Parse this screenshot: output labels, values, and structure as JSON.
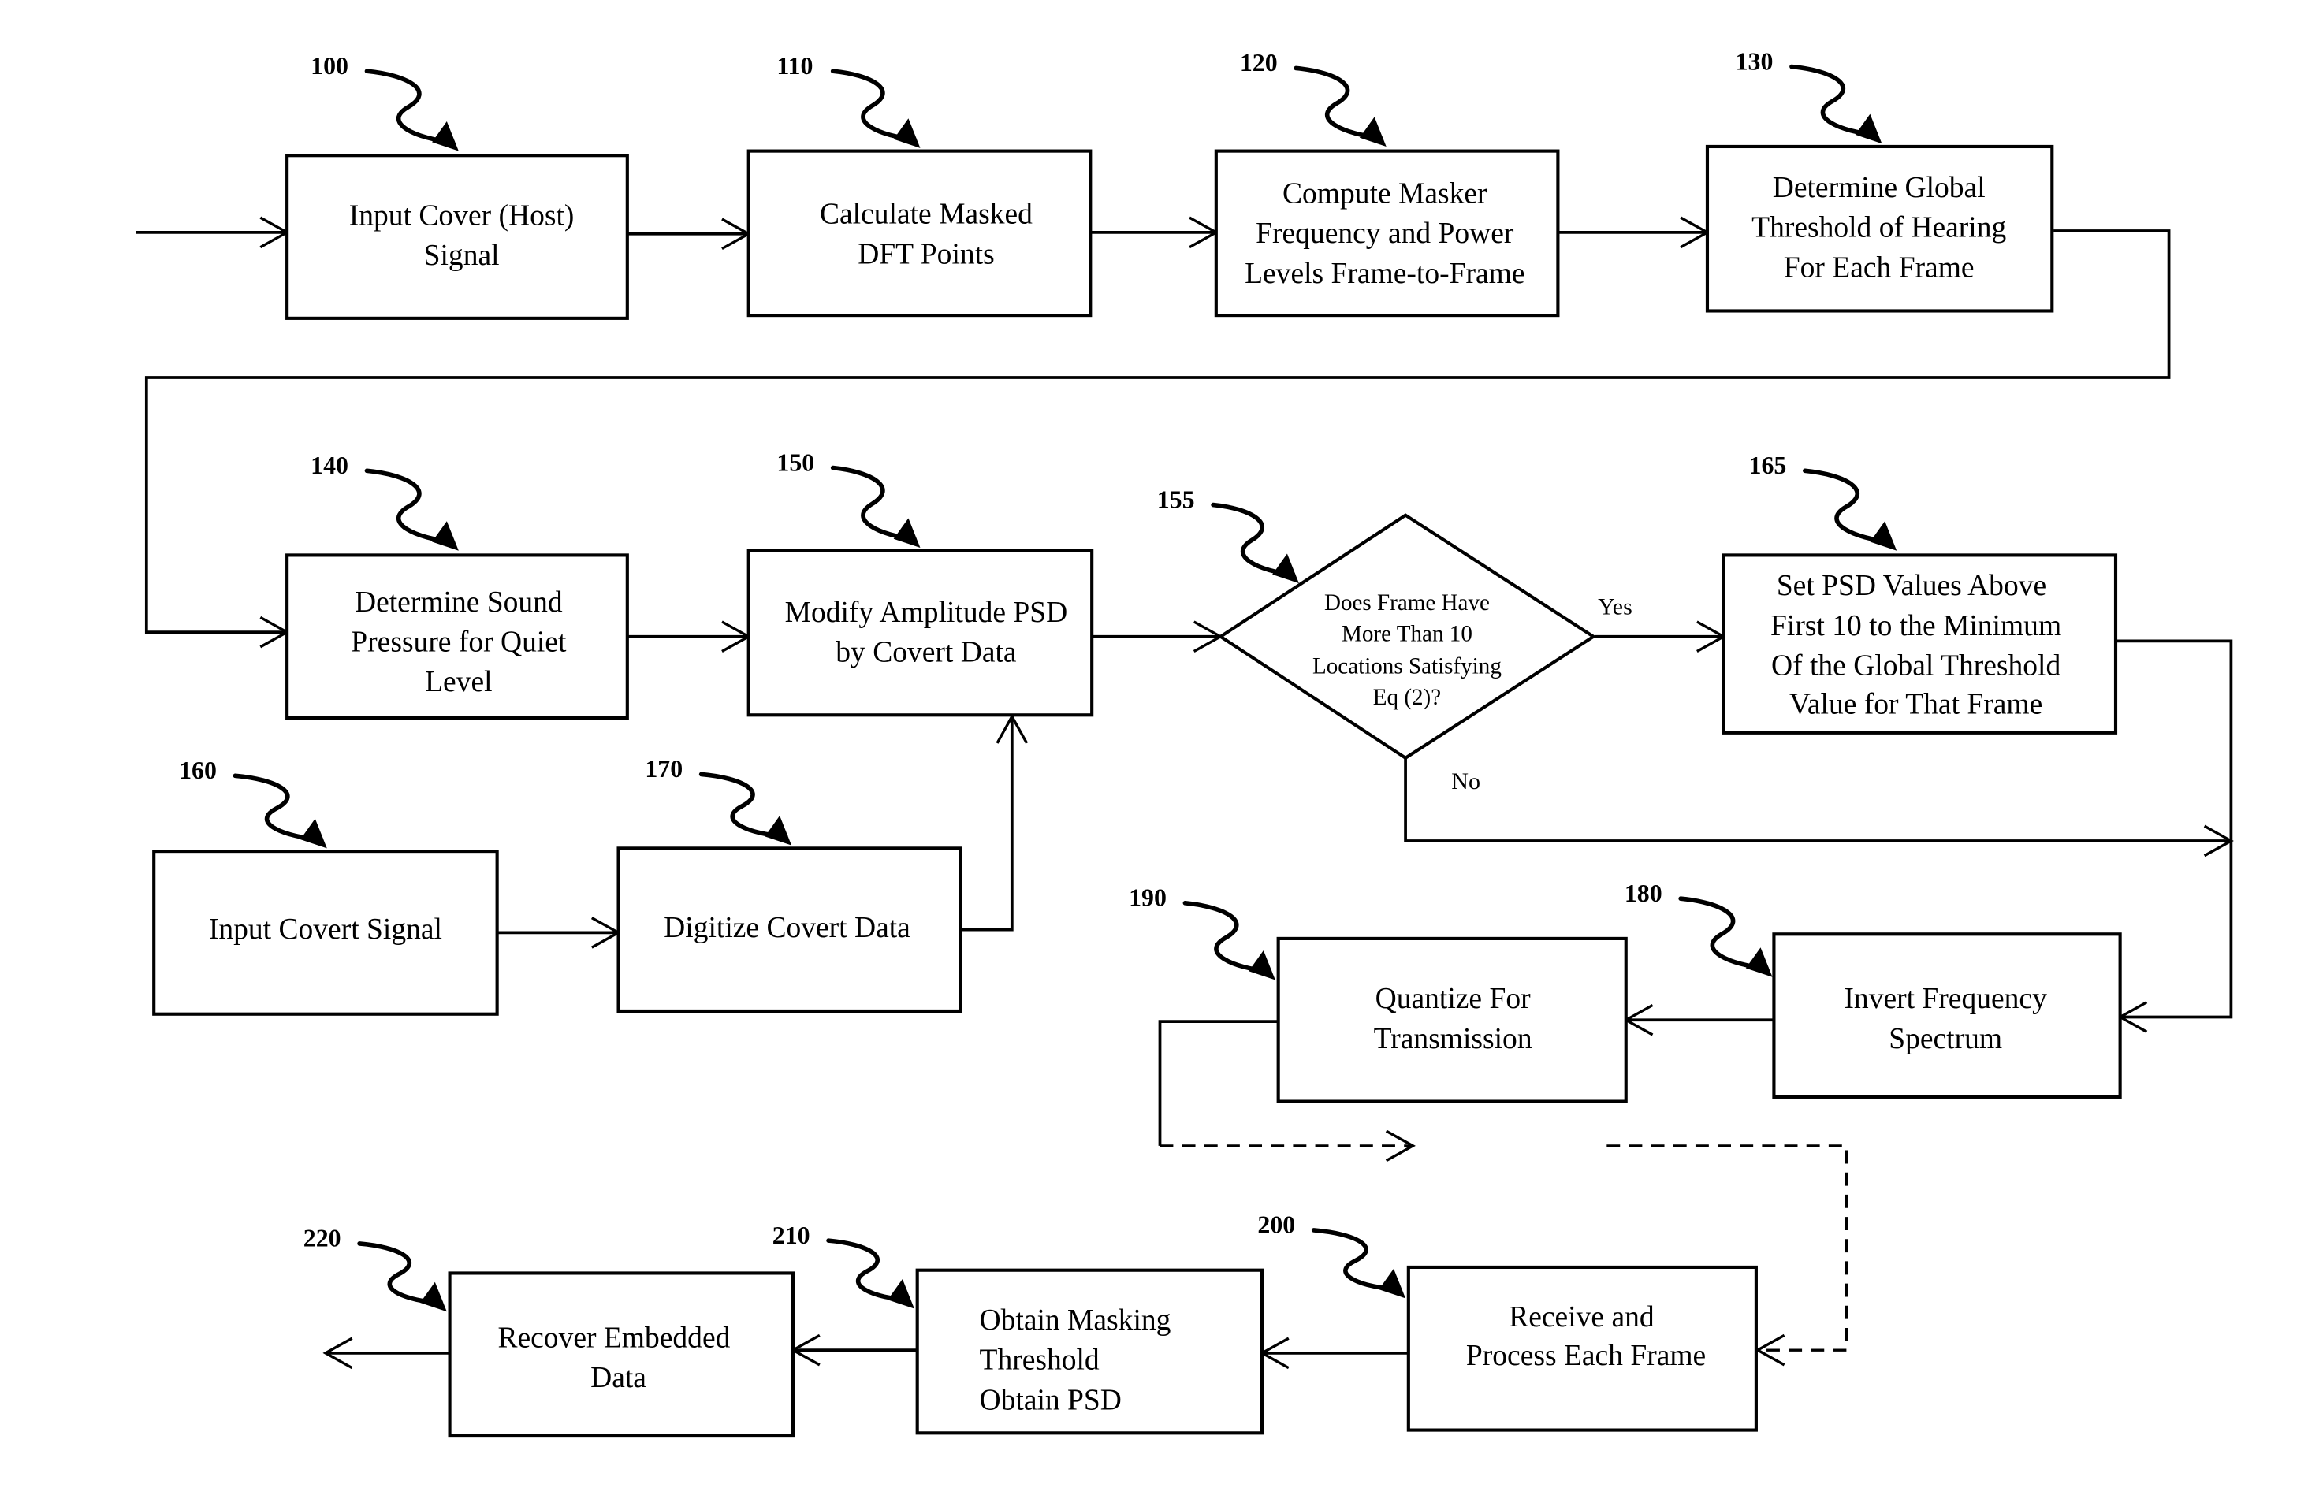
{
  "diagram": {
    "type": "flowchart",
    "steps": [
      {
        "ref": "100",
        "lines": [
          "Input Cover (Host)",
          "Signal"
        ]
      },
      {
        "ref": "110",
        "lines": [
          "Calculate Masked",
          "DFT Points"
        ]
      },
      {
        "ref": "120",
        "lines": [
          "Compute Masker",
          "Frequency and Power",
          "Levels Frame-to-Frame"
        ]
      },
      {
        "ref": "130",
        "lines": [
          "Determine Global",
          "Threshold of Hearing",
          "For Each Frame"
        ]
      },
      {
        "ref": "140",
        "lines": [
          "Determine Sound",
          "Pressure for Quiet",
          "Level"
        ]
      },
      {
        "ref": "150",
        "lines": [
          "Modify Amplitude PSD",
          "by Covert Data"
        ]
      },
      {
        "ref": "155",
        "lines": [
          "Does Frame Have",
          "More Than 10",
          "Locations Satisfying",
          "Eq  (2)?"
        ]
      },
      {
        "ref": "165",
        "lines": [
          "Set PSD Values Above",
          "First 10 to the Minimum",
          "Of the Global Threshold",
          "Value for That Frame"
        ]
      },
      {
        "ref": "160",
        "lines": [
          "Input Covert Signal"
        ]
      },
      {
        "ref": "170",
        "lines": [
          "Digitize Covert Data"
        ]
      },
      {
        "ref": "180",
        "lines": [
          "Invert Frequency",
          "Spectrum"
        ]
      },
      {
        "ref": "190",
        "lines": [
          "Quantize For",
          "Transmission"
        ]
      },
      {
        "ref": "200",
        "lines": [
          "Receive and",
          "Process Each Frame"
        ]
      },
      {
        "ref": "210",
        "lines": [
          "Obtain Masking",
          "Threshold",
          "Obtain PSD"
        ]
      },
      {
        "ref": "220",
        "lines": [
          "Recover Embedded",
          "Data"
        ]
      }
    ],
    "branches": {
      "yes": "Yes",
      "no": "No"
    }
  }
}
